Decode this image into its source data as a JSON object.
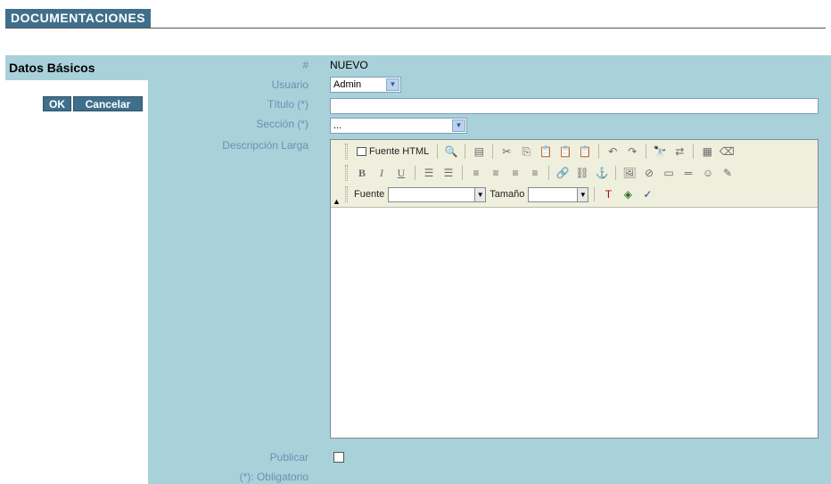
{
  "header": {
    "title": "DOCUMENTACIONES"
  },
  "left": {
    "title": "Datos Básicos",
    "ok_label": "OK",
    "cancel_label": "Cancelar"
  },
  "form": {
    "id_label": "#",
    "id_value": "NUEVO",
    "usuario_label": "Usuario",
    "usuario_value": "Admin",
    "titulo_label": "Título (*)",
    "titulo_value": "",
    "seccion_label": "Sección (*)",
    "seccion_value": "...",
    "descripcion_label": "Descripción Larga",
    "publicar_label": "Publicar",
    "publicar_checked": false,
    "obligatorio_note": "(*): Obligatorio"
  },
  "editor": {
    "source_label": "Fuente HTML",
    "font_label": "Fuente",
    "font_value": "",
    "size_label": "Tamaño",
    "size_value": "",
    "collapse_glyph": "▲"
  },
  "colors": {
    "accent": "#3f6f8a",
    "panel": "#a9d1da",
    "label": "#6a8fb5"
  }
}
